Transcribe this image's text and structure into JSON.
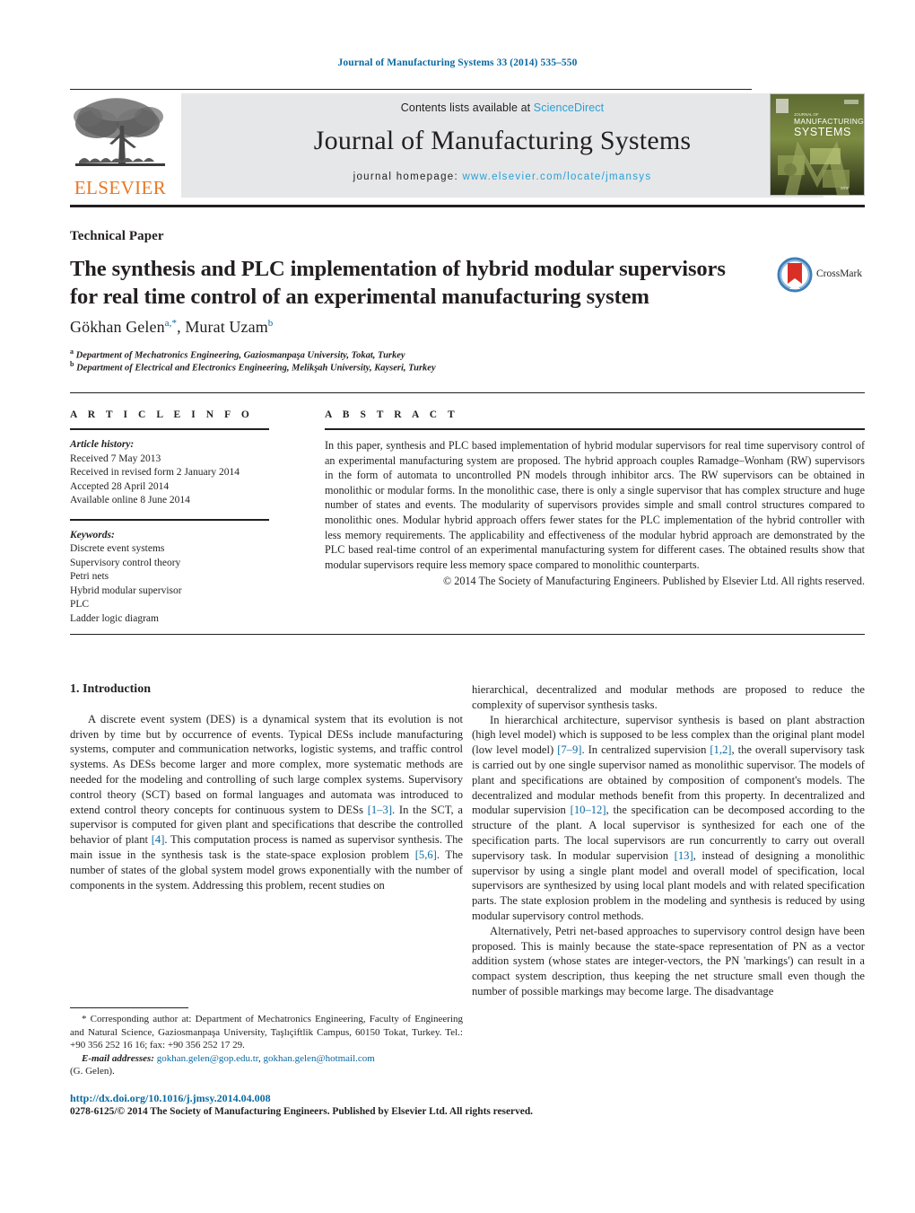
{
  "running_head": "Journal of Manufacturing Systems 33 (2014) 535–550",
  "masthead": {
    "publisher_name": "ELSEVIER",
    "contents_prefix": "Contents lists available at ",
    "contents_link": "ScienceDirect",
    "journal_name": "Journal of Manufacturing Systems",
    "homepage_prefix": "journal homepage: ",
    "homepage_url": "www.elsevier.com/locate/jmansys",
    "cover_title_small": "JOURNAL OF",
    "cover_title_line1": "MANUFACTURING",
    "cover_title_line2": "SYSTEMS",
    "cover_brand": "sme"
  },
  "article": {
    "type": "Technical Paper",
    "title": "The synthesis and PLC implementation of hybrid modular supervisors for real time control of an experimental manufacturing system",
    "crossmark_label": "CrossMark",
    "authors": "Gökhan Gelen",
    "author_sup_1": "a,",
    "author_star": "*",
    "author_2": ", Murat Uzam",
    "author_sup_2": "b",
    "affiliation_a_sup": "a",
    "affiliation_a": "Department of Mechatronics Engineering, Gaziosmanpaşa University, Tokat, Turkey",
    "affiliation_b_sup": "b",
    "affiliation_b": "Department of Electrical and Electronics Engineering, Melikşah University, Kayseri, Turkey"
  },
  "info": {
    "section_label": "A R T I C L E   I N F O",
    "history_heading": "Article history:",
    "history": [
      "Received 7 May 2013",
      "Received in revised form 2 January 2014",
      "Accepted 28 April 2014",
      "Available online 8 June 2014"
    ],
    "keywords_heading": "Keywords:",
    "keywords": [
      "Discrete event systems",
      "Supervisory control theory",
      "Petri nets",
      "Hybrid modular supervisor",
      "PLC",
      "Ladder logic diagram"
    ]
  },
  "abstract": {
    "section_label": "A B S T R A C T",
    "text": "In this paper, synthesis and PLC based implementation of hybrid modular supervisors for real time supervisory control of an experimental manufacturing system are proposed. The hybrid approach couples Ramadge–Wonham (RW) supervisors in the form of automata to uncontrolled PN models through inhibitor arcs. The RW supervisors can be obtained in monolithic or modular forms. In the monolithic case, there is only a single supervisor that has complex structure and huge number of states and events. The modularity of supervisors provides simple and small control structures compared to monolithic ones. Modular hybrid approach offers fewer states for the PLC implementation of the hybrid controller with less memory requirements. The applicability and effectiveness of the modular hybrid approach are demonstrated by the PLC based real-time control of an experimental manufacturing system for different cases. The obtained results show that modular supervisors require less memory space compared to monolithic counterparts.",
    "copyright": "© 2014 The Society of Manufacturing Engineers. Published by Elsevier Ltd. All rights reserved."
  },
  "body": {
    "section_number_title": "1.  Introduction",
    "left_paragraph_1_a": "A discrete event system (DES) is a dynamical system that its evolution is not driven by time but by occurrence of events. Typical DESs include manufacturing systems, computer and communication networks, logistic systems, and traffic control systems. As DESs become larger and more complex, more systematic methods are needed for the modeling and controlling of such large complex systems. Supervisory control theory (SCT) based on formal languages and automata was introduced to extend control theory concepts for continuous system to DESs ",
    "ref_1_3": "[1–3]",
    "left_paragraph_1_b": ". In the SCT, a supervisor is computed for given plant and specifications that describe the controlled behavior of plant ",
    "ref_4": "[4]",
    "left_paragraph_1_c": ". This computation process is named as supervisor synthesis. The main issue in the synthesis task is the state-space explosion problem ",
    "ref_5_6": "[5,6]",
    "left_paragraph_1_d": ". The number of states of the global system model grows exponentially with the number of components in the system. Addressing this problem, recent studies on",
    "right_paragraph_0": "hierarchical, decentralized and modular methods are proposed to reduce the complexity of supervisor synthesis tasks.",
    "right_paragraph_1_a": "In hierarchical architecture, supervisor synthesis is based on plant abstraction (high level model) which is supposed to be less complex than the original plant model (low level model) ",
    "ref_7_9": "[7–9]",
    "right_paragraph_1_b": ". In centralized supervision ",
    "ref_1_2": "[1,2]",
    "right_paragraph_1_c": ", the overall supervisory task is carried out by one single supervisor named as monolithic supervisor. The models of plant and specifications are obtained by composition of component's models. The decentralized and modular methods benefit from this property. In decentralized and modular supervision ",
    "ref_10_12": "[10–12]",
    "right_paragraph_1_d": ", the specification can be decomposed according to the structure of the plant. A local supervisor is synthesized for each one of the specification parts. The local supervisors are run concurrently to carry out overall supervisory task. In modular supervision ",
    "ref_13": "[13]",
    "right_paragraph_1_e": ", instead of designing a monolithic supervisor by using a single plant model and overall model of specification, local supervisors are synthesized by using local plant models and with related specification parts. The state explosion problem in the modeling and synthesis is reduced by using modular supervisory control methods.",
    "right_paragraph_2": "Alternatively, Petri net-based approaches to supervisory control design have been proposed. This is mainly because the state-space representation of PN as a vector addition system (whose states are integer-vectors, the PN 'markings') can result in a compact system description, thus keeping the net structure small even though the number of possible markings may become large. The disadvantage"
  },
  "footnote": {
    "star": "*",
    "corresponding": " Corresponding author at: Department of Mechatronics Engineering, Faculty of Engineering and Natural Science, Gaziosmanpaşa University, Taşlıçiftlik Campus, 60150 Tokat, Turkey. Tel.: +90 356 252 16 16; fax: +90 356 252 17 29.",
    "email_label": "E-mail addresses:",
    "email_1": "gokhan.gelen@gop.edu.tr",
    "email_sep": ", ",
    "email_2": "gokhan.gelen@hotmail.com",
    "email_attrib": "(G. Gelen)."
  },
  "bottom": {
    "doi": "http://dx.doi.org/10.1016/j.jmsy.2014.04.008",
    "copyright": "0278-6125/© 2014 The Society of Manufacturing Engineers. Published by Elsevier Ltd. All rights reserved."
  },
  "colors": {
    "link_blue": "#0a6aa1",
    "sciencedirect_blue": "#2a9fd6",
    "elsevier_orange": "#E87722",
    "ink": "#231f20",
    "band_gray": "#e6e7e8"
  }
}
